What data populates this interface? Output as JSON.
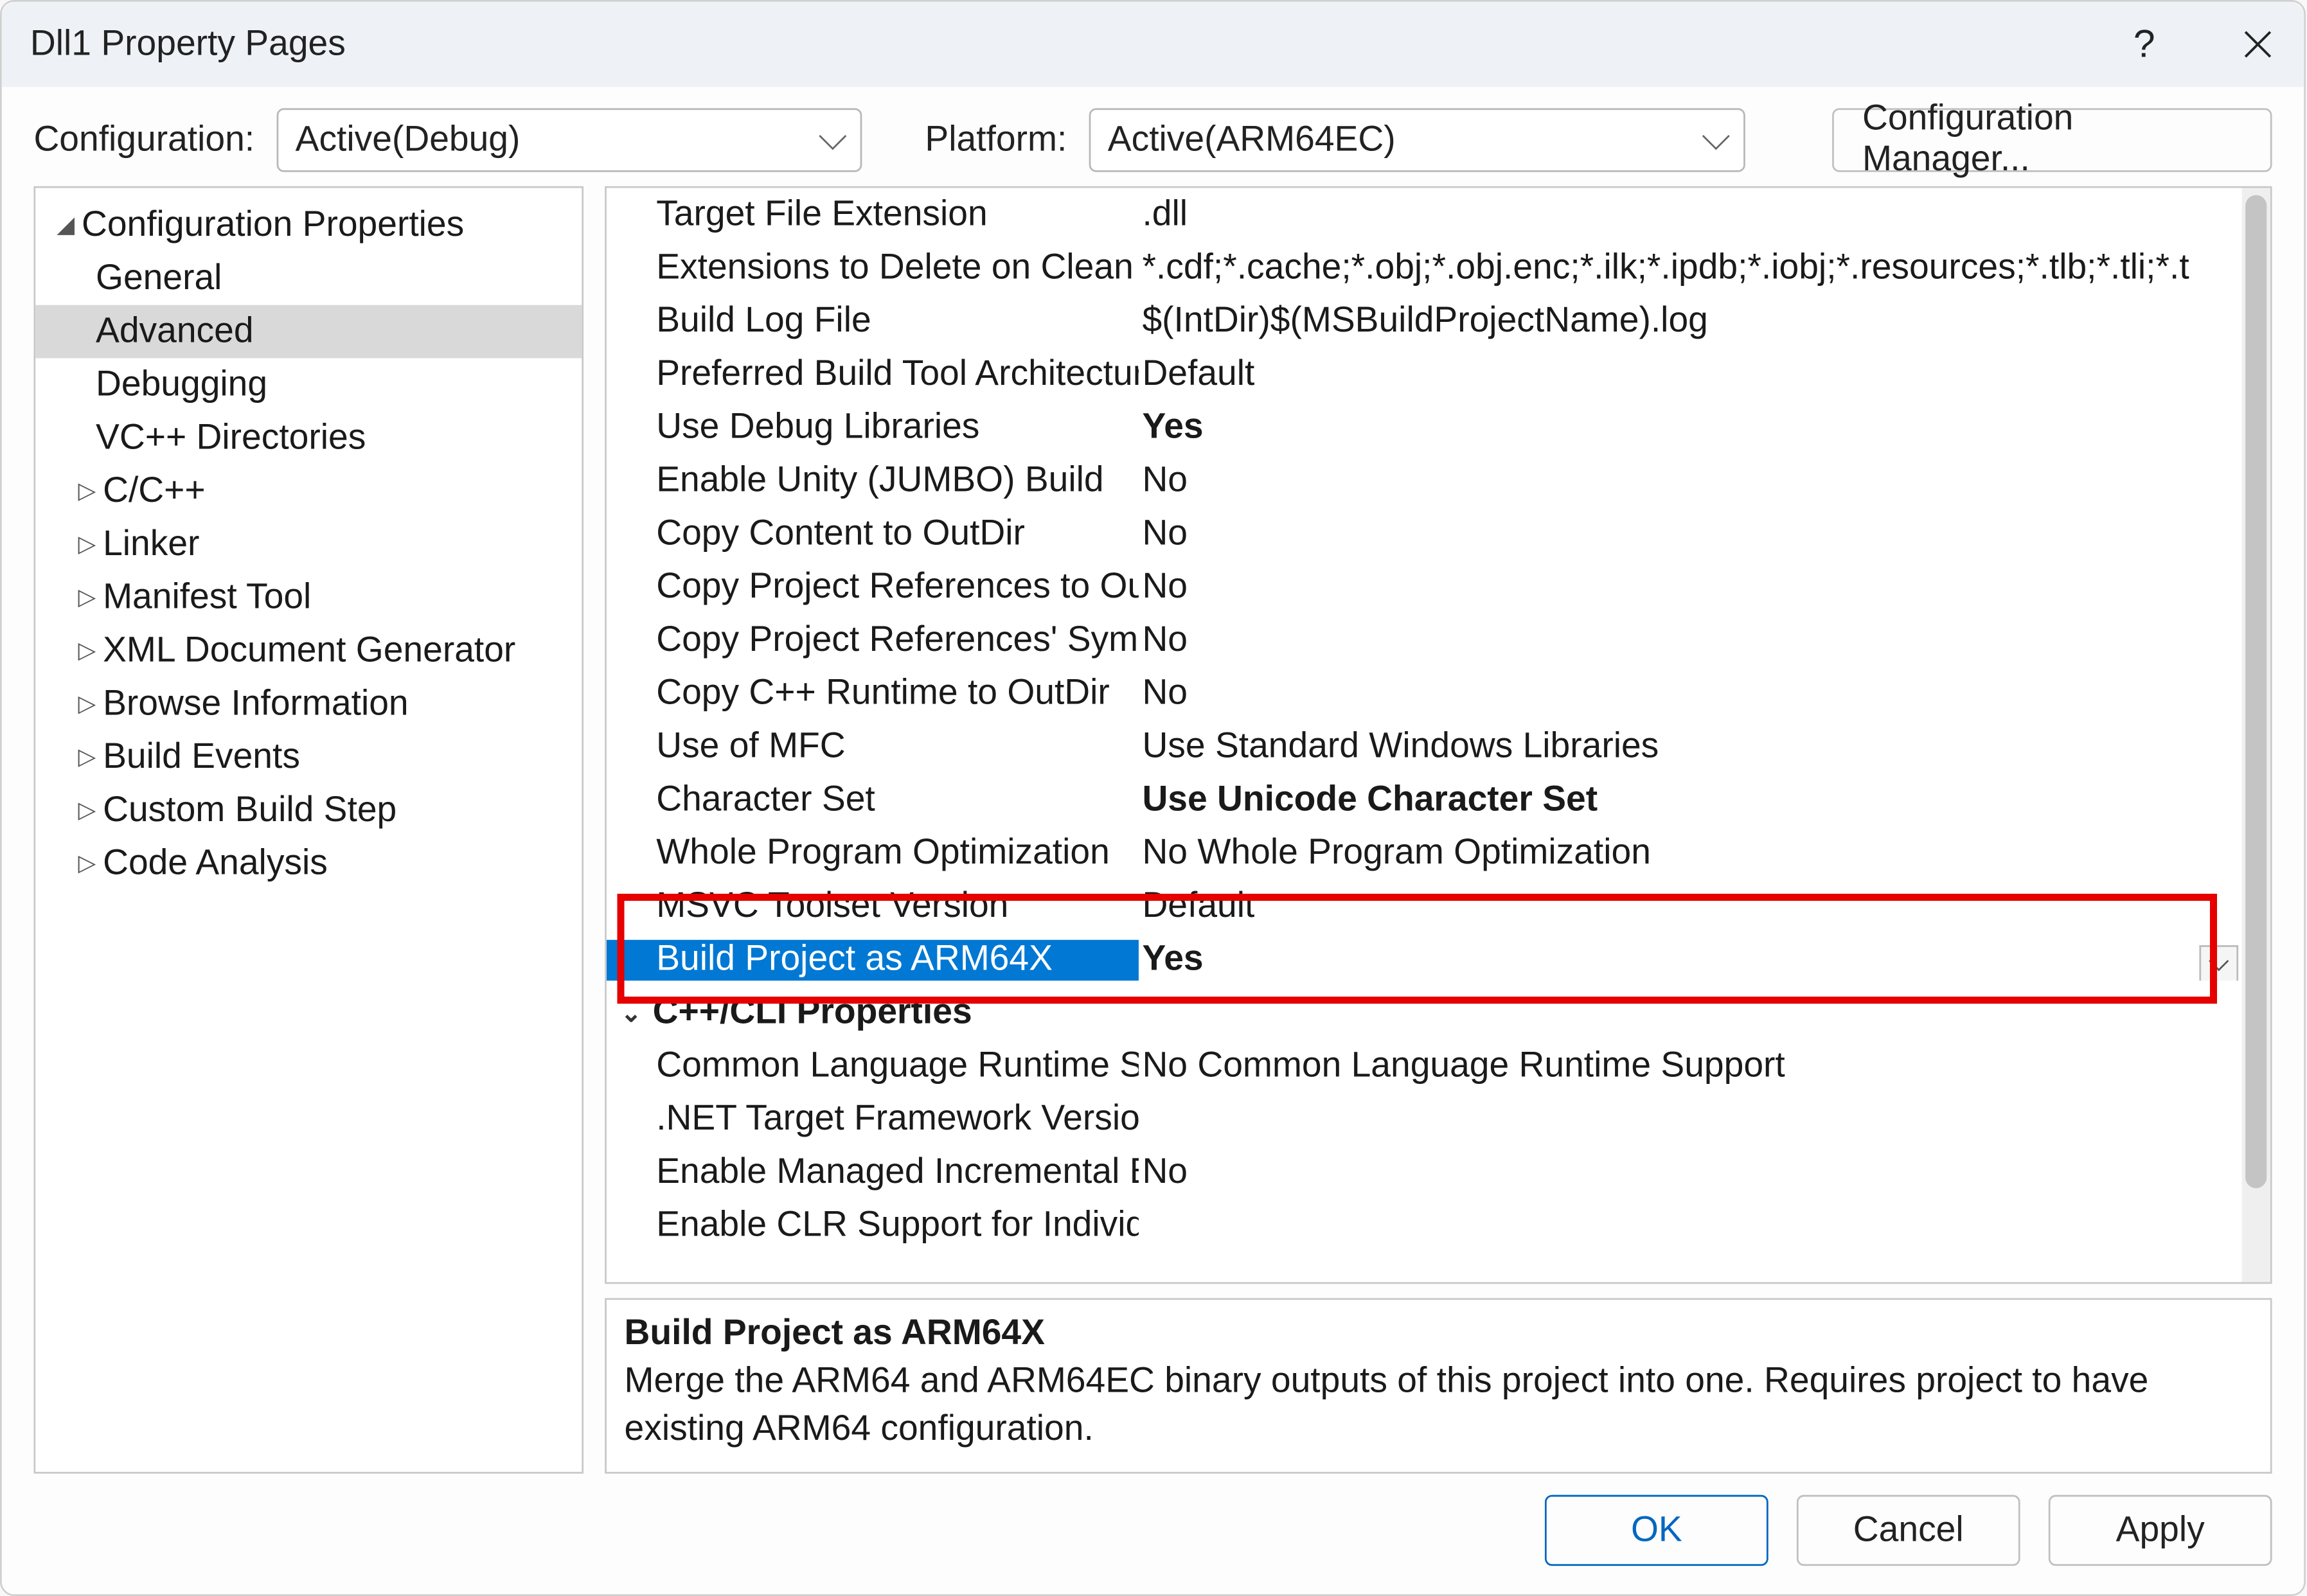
{
  "window": {
    "title": "Dll1 Property Pages"
  },
  "toolbar": {
    "configuration_label": "Configuration:",
    "configuration_value": "Active(Debug)",
    "platform_label": "Platform:",
    "platform_value": "Active(ARM64EC)",
    "config_manager_label": "Configuration Manager..."
  },
  "tree": {
    "root": "Configuration Properties",
    "items": [
      "General",
      "Advanced",
      "Debugging",
      "VC++ Directories",
      "C/C++",
      "Linker",
      "Manifest Tool",
      "XML Document Generator",
      "Browse Information",
      "Build Events",
      "Custom Build Step",
      "Code Analysis"
    ],
    "selected": "Advanced"
  },
  "grid": {
    "section_cppcli": "C++/CLI Properties",
    "rows": [
      {
        "name": "Target File Extension",
        "value": ".dll"
      },
      {
        "name": "Extensions to Delete on Clean",
        "value": "*.cdf;*.cache;*.obj;*.obj.enc;*.ilk;*.ipdb;*.iobj;*.resources;*.tlb;*.tli;*.t"
      },
      {
        "name": "Build Log File",
        "value": "$(IntDir)$(MSBuildProjectName).log"
      },
      {
        "name": "Preferred Build Tool Architecture",
        "value": "Default"
      },
      {
        "name": "Use Debug Libraries",
        "value": "Yes",
        "bold": true
      },
      {
        "name": "Enable Unity (JUMBO) Build",
        "value": "No"
      },
      {
        "name": "Copy Content to OutDir",
        "value": "No"
      },
      {
        "name": "Copy Project References to OutDi",
        "value": "No"
      },
      {
        "name": "Copy Project References' Symbols",
        "value": "No"
      },
      {
        "name": "Copy C++ Runtime to OutDir",
        "value": "No"
      },
      {
        "name": "Use of MFC",
        "value": "Use Standard Windows Libraries"
      },
      {
        "name": "Character Set",
        "value": "Use Unicode Character Set",
        "bold": true
      },
      {
        "name": "Whole Program Optimization",
        "value": "No Whole Program Optimization"
      },
      {
        "name": "MSVC Toolset Version",
        "value": "Default"
      },
      {
        "name": "Build Project as ARM64X",
        "value": "Yes",
        "selected": true,
        "bold": true
      },
      {
        "name": "Common Language Runtime Sup",
        "value": "No Common Language Runtime Support"
      },
      {
        "name": ".NET Target Framework Version",
        "value": ""
      },
      {
        "name": "Enable Managed Incremental Buil",
        "value": "No"
      },
      {
        "name": "Enable CLR Support for Individual",
        "value": ""
      }
    ]
  },
  "description": {
    "title": "Build Project as ARM64X",
    "body": "Merge the ARM64 and ARM64EC binary outputs of this project into one. Requires project to have existing ARM64 configuration."
  },
  "footer": {
    "ok": "OK",
    "cancel": "Cancel",
    "apply": "Apply"
  },
  "colors": {
    "selection_bg": "#0078d4",
    "highlight_border": "#e60000",
    "tree_sel_bg": "#d9d9d9"
  }
}
